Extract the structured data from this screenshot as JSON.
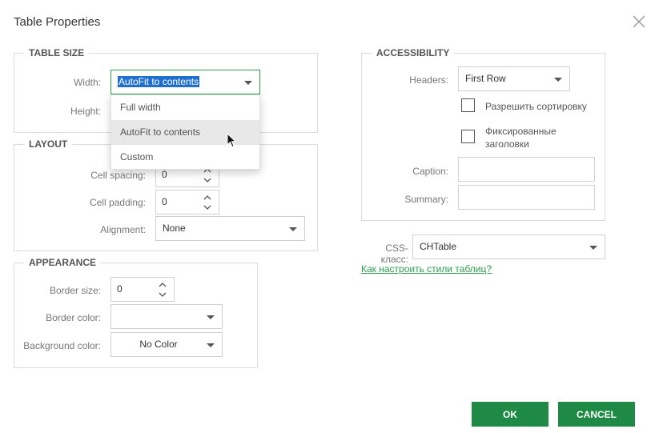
{
  "dialog": {
    "title": "Table Properties"
  },
  "table_size": {
    "legend": "TABLE SIZE",
    "width_label": "Width:",
    "width_value": "AutoFit to contents",
    "height_label": "Height:"
  },
  "width_dropdown": {
    "options": [
      "Full width",
      "AutoFit to contents",
      "Custom"
    ],
    "hovered": "AutoFit to contents"
  },
  "layout": {
    "legend": "LAYOUT",
    "cell_spacing_label": "Cell spacing:",
    "cell_spacing_value": "0",
    "cell_padding_label": "Cell padding:",
    "cell_padding_value": "0",
    "alignment_label": "Alignment:",
    "alignment_value": "None"
  },
  "appearance": {
    "legend": "APPEARANCE",
    "border_size_label": "Border size:",
    "border_size_value": "0",
    "border_color_label": "Border color:",
    "border_color_value": "",
    "background_color_label": "Background color:",
    "background_color_value": "No Color"
  },
  "accessibility": {
    "legend": "ACCESSIBILITY",
    "headers_label": "Headers:",
    "headers_value": "First Row",
    "sortable_label": "Разрешить сортировку",
    "sortable_checked": false,
    "fixed_headers_label_line1": "Фиксированные",
    "fixed_headers_label_line2": "заголовки",
    "fixed_headers_checked": false,
    "caption_label": "Caption:",
    "caption_value": "",
    "summary_label": "Summary:",
    "summary_value": ""
  },
  "css_class": {
    "label": "CSS-класс:",
    "value": "CHTable",
    "help_link": "Как настроить стили таблиц?"
  },
  "buttons": {
    "ok": "OK",
    "cancel": "CANCEL"
  },
  "colors": {
    "accent_green": "#1e8a45",
    "link_green": "#2e9e52",
    "selection_blue": "#1f6fd1"
  },
  "icons": {
    "close": "close-icon",
    "caret": "chevron-down-icon",
    "spinner": "spinner-arrows-icon",
    "cursor": "mouse-pointer-icon"
  }
}
